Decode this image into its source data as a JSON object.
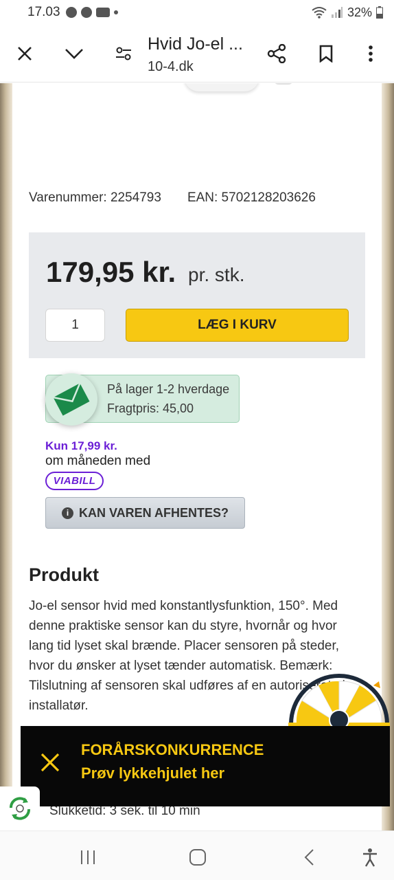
{
  "status_bar": {
    "time": "17.03",
    "battery": "32%"
  },
  "browser": {
    "title": "Hvid Jo-el ...",
    "url": "10-4.dk"
  },
  "product": {
    "item_number": "Varenummer: 2254793",
    "ean": "EAN: 5702128203626",
    "price": "179,95 kr.",
    "price_unit": "pr. stk.",
    "quantity": "1",
    "add_to_cart": "LÆG I KURV",
    "stock_line1": "På lager 1-2 hverdage",
    "stock_line2": "Fragtpris: 45,00",
    "viabill_price": "Kun 17,99 kr.",
    "viabill_text": "om måneden med",
    "viabill_logo": "VIABILL",
    "pickup_button": "KAN VAREN AFHENTES?"
  },
  "description": {
    "heading": "Produkt",
    "text": "Jo-el sensor hvid med konstantlysfunktion, 150°. Med denne praktiske sensor kan du styre, hvornår og hvor lang tid lyset skal brænde. Placer sensoren på steder, hvor du ønsker at lyset tænder automatisk. Bemærk: Tilslutning af sensoren skal udføres af en autoriseret el-installatør.",
    "bullet": "Slukketid: 3 sek. til 10 min"
  },
  "promo": {
    "line1": "FORÅRSKONKURRENCE",
    "line2": "Prøv lykkehjulet her"
  },
  "colors": {
    "accent": "#f7c812",
    "viabill": "#6b1fd6",
    "stock_bg": "#d5ecdf",
    "stock_icon": "#1b8a4a",
    "banner_bg": "#080808"
  }
}
